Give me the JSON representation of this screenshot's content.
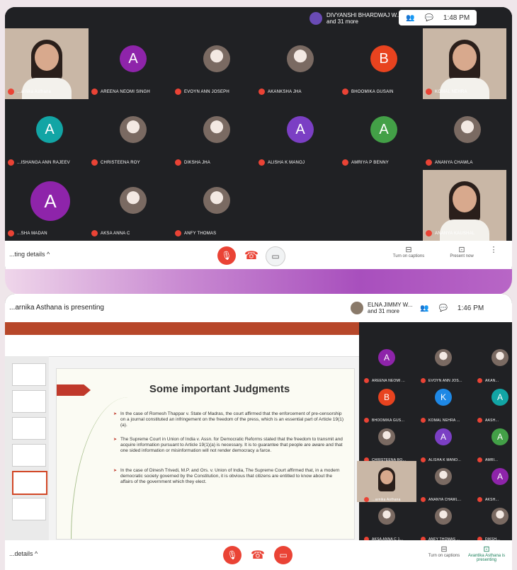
{
  "screen1": {
    "presenter_chip": {
      "line1": "DIVYANSHI BHARDWAJ W...",
      "line2": "and 31 more"
    },
    "time": "1:48 PM",
    "tiles": [
      {
        "name": "...arnika Asthana",
        "initial": "",
        "color": "",
        "kind": "video"
      },
      {
        "name": "AREENA NEOMI SINGH",
        "initial": "A",
        "color": "#8e24aa",
        "kind": "avatar"
      },
      {
        "name": "EVOYN ANN JOSEPH",
        "initial": "",
        "color": "",
        "kind": "photo"
      },
      {
        "name": "AKANKSHA JHA",
        "initial": "",
        "color": "",
        "kind": "photo"
      },
      {
        "name": "BHOOMIKA GUSAIN",
        "initial": "B",
        "color": "#e8431f",
        "kind": "avatar"
      },
      {
        "name": "KOMAL NEHRA",
        "initial": "",
        "color": "",
        "kind": "video"
      },
      {
        "name": "...ISHANGA ANN RAJEEV",
        "initial": "A",
        "color": "#12a5a5",
        "kind": "avatar"
      },
      {
        "name": "CHRISTEENA ROY",
        "initial": "",
        "color": "",
        "kind": "photo"
      },
      {
        "name": "DIKSHA JHA",
        "initial": "",
        "color": "",
        "kind": "photo"
      },
      {
        "name": "ALISHA K MANOJ",
        "initial": "A",
        "color": "#7b3fc4",
        "kind": "avatar"
      },
      {
        "name": "AMRIYA P BENNY",
        "initial": "A",
        "color": "#43a047",
        "kind": "avatar"
      },
      {
        "name": "ANANYA CHAWLA",
        "initial": "",
        "color": "",
        "kind": "photo"
      },
      {
        "name": "...SHA MADAN",
        "initial": "A",
        "color": "#8e24aa",
        "kind": "avatar"
      },
      {
        "name": "AKSA ANNA C",
        "initial": "",
        "color": "",
        "kind": "photo"
      },
      {
        "name": "ANFY THOMAS",
        "initial": "",
        "color": "",
        "kind": "photo"
      },
      {
        "name": "ANANYA KAUSHAL",
        "initial": "",
        "color": "",
        "kind": "video"
      }
    ],
    "meeting_details": "...ting details ^",
    "captions": "Turn on captions",
    "present": "Present now"
  },
  "screen2": {
    "presenting_text": "...arnika Asthana is presenting",
    "presenter_chip": {
      "line1": "ELNA JIMMY W...",
      "line2": "and 31 more"
    },
    "time": "1:46 PM",
    "slide": {
      "title": "Some important Judgments",
      "bullets": [
        "In the case of Romesh Thappar v. State of Madras, the court affirmed that the enforcement of pre-censorship on a journal constituted an infringement on the freedom of the press, which is an essential part of Article 19(1)(a).",
        "The Supreme Court in Union of India v. Assn. for Democratic Reforms stated that the freedom to transmit and acquire information pursuant to Article 19(1)(a) is necessary. It is to guarantee that people are aware and that one sided information or misinformation will not render democracy a farce.",
        "In the case of Dinesh Trivedi, M.P. and Ors. v. Union of India, The Supreme Court affirmed that, in a modern democratic society governed by the Constitution, it is obvious that citizens are entitled to know about the affairs of the government which they elect."
      ]
    },
    "tiles": [
      {
        "name": "AREENA NEOMI ...",
        "initial": "A",
        "color": "#8e24aa"
      },
      {
        "name": "EVOYN ANN JOS...",
        "initial": "",
        "color": ""
      },
      {
        "name": "AKAN...",
        "initial": "",
        "color": ""
      },
      {
        "name": "BHOOMIKA GUS...",
        "initial": "B",
        "color": "#e8431f"
      },
      {
        "name": "KOMAL NEHRA ...",
        "initial": "K",
        "color": "#1e88e5"
      },
      {
        "name": "AASH...",
        "initial": "A",
        "color": "#12a5a5"
      },
      {
        "name": "CHRISTEENA RO...",
        "initial": "",
        "color": ""
      },
      {
        "name": "ALISHA K MANO...",
        "initial": "A",
        "color": "#7b3fc4"
      },
      {
        "name": "AMRI...",
        "initial": "A",
        "color": "#43a047"
      },
      {
        "name": "...arnika Asthana",
        "initial": "",
        "color": ""
      },
      {
        "name": "ANANYA CHAWL...",
        "initial": "",
        "color": ""
      },
      {
        "name": "AKSH...",
        "initial": "A",
        "color": "#8e24aa"
      },
      {
        "name": "AKSA ANNA C 1...",
        "initial": "",
        "color": ""
      },
      {
        "name": "ANFY THOMAS ...",
        "initial": "",
        "color": ""
      },
      {
        "name": "DIKSH...",
        "initial": "",
        "color": ""
      }
    ],
    "meeting_details": "...details ^",
    "captions": "Turn on captions",
    "present": "Avantika Asthana is presenting"
  }
}
